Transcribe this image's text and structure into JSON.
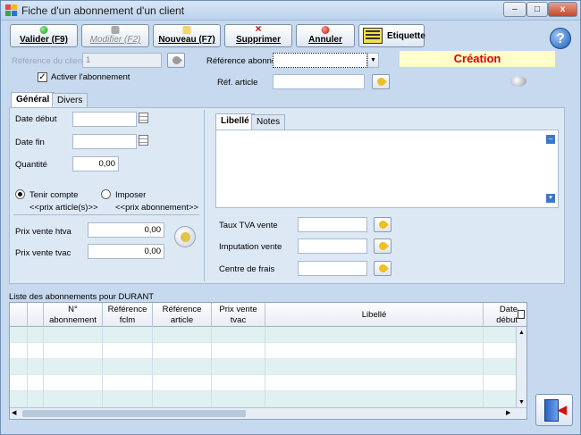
{
  "window": {
    "title": "Fiche d'un abonnement d'un client",
    "min_label": "–",
    "max_label": "□",
    "close_label": "x"
  },
  "toolbar": {
    "valider": "Valider (F9)",
    "modifier": "Modifier (F2)",
    "nouveau": "Nouveau (F7)",
    "supprimer": "Supprimer",
    "annuler": "Annuler",
    "etiquette": "Etiquette"
  },
  "form": {
    "ref_client_label": "Référence du client",
    "ref_client_value": "1",
    "activer_label": "Activer l'abonnement",
    "activer_checked": true,
    "ref_abonne_label": "Référence abonne",
    "ref_abonne_value": "",
    "status": "Création",
    "ref_article_label": "Réf. article",
    "ref_article_value": ""
  },
  "tabs_left": [
    "Général",
    "Divers"
  ],
  "general": {
    "date_debut_label": "Date début",
    "date_fin_label": "Date fin",
    "quantite_label": "Quantité",
    "quantite_value": "0,00",
    "radio1_label": "Tenir compte",
    "radio1_sub": "<<prix article(s)>>",
    "radio2_label": "Imposer",
    "radio2_sub": "<<prix abonnement>>",
    "prix_htva_label": "Prix vente htva",
    "prix_htva_value": "0,00",
    "prix_tvac_label": "Prix vente tvac",
    "prix_tvac_value": "0,00"
  },
  "tabs_right": [
    "Libellé",
    "Notes"
  ],
  "right": {
    "taux_tva_label": "Taux TVA vente",
    "imputation_label": "Imputation vente",
    "centre_label": "Centre de frais"
  },
  "list": {
    "title": "Liste des abonnements pour DURANT",
    "columns": [
      "",
      "",
      "N°\nabonnement",
      "Référence\nfclm",
      "Référence\narticle",
      "Prix vente\ntvac",
      "Libellé",
      "Date\ndébut"
    ]
  },
  "colors": {
    "window_bg": "#c7d9ee",
    "status_text": "#e00000",
    "status_bg": "#ffffcc"
  }
}
